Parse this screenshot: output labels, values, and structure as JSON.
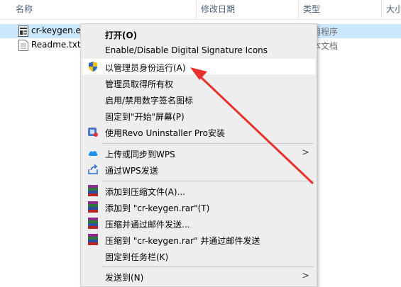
{
  "columns": {
    "name": "名称",
    "date": "修改日期",
    "type": "类型",
    "size": "大小"
  },
  "files": [
    {
      "name": "cr-keygen.e",
      "type": "用程序",
      "selected": true,
      "icon": "keygen-exe-icon"
    },
    {
      "name": "Readme.txt",
      "type": "本文档",
      "selected": false,
      "icon": "text-file-icon"
    }
  ],
  "menu": {
    "items": [
      {
        "label": "打开(O)",
        "icon": "",
        "bold": true
      },
      {
        "label": "Enable/Disable Digital Signature Icons",
        "icon": ""
      },
      {
        "label": "以管理员身份运行(A)",
        "icon": "uac-shield-icon",
        "highlighted": true
      },
      {
        "label": "管理员取得所有权",
        "icon": ""
      },
      {
        "label": "启用/禁用数字签名图标",
        "icon": ""
      },
      {
        "label": "固定到\"开始\"屏幕(P)",
        "icon": ""
      },
      {
        "label": "使用Revo Uninstaller Pro安装",
        "icon": "revo-uninstaller-icon"
      },
      {
        "label": "上传或同步到WPS",
        "icon": "wps-cloud-icon",
        "submenu": true
      },
      {
        "label": "通过WPS发送",
        "icon": "share-icon"
      },
      {
        "label": "添加到压缩文件(A)...",
        "icon": "winrar-icon"
      },
      {
        "label": "添加到 \"cr-keygen.rar\"(T)",
        "icon": "winrar-icon"
      },
      {
        "label": "压缩并通过邮件发送...",
        "icon": "winrar-icon"
      },
      {
        "label": "压缩到 \"cr-keygen.rar\" 并通过邮件发送",
        "icon": "winrar-icon"
      },
      {
        "label": "固定到任务栏(K)",
        "icon": ""
      },
      {
        "label": "发送到(N)",
        "icon": "",
        "submenu": true
      }
    ],
    "submenu_glyph": ">"
  },
  "colors": {
    "selection": "#cce8ff",
    "menu_bg": "#eeeeee",
    "arrow": "#e8312a"
  }
}
